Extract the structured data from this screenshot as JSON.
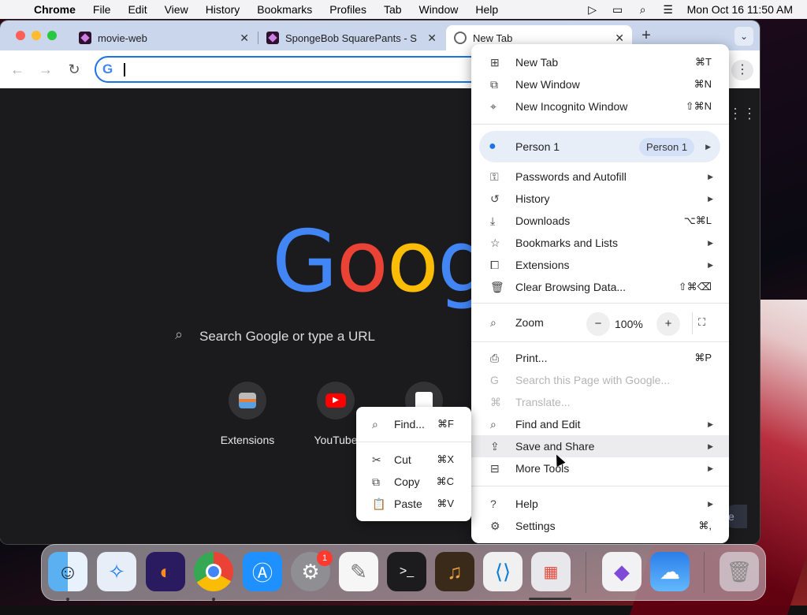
{
  "menubar": {
    "app_name": "Chrome",
    "items": [
      "File",
      "Edit",
      "View",
      "History",
      "Bookmarks",
      "Profiles",
      "Tab",
      "Window",
      "Help"
    ],
    "clock": "Mon Oct 16  11:50 AM"
  },
  "tabs": [
    {
      "title": "movie-web"
    },
    {
      "title": "SpongeBob SquarePants - S"
    },
    {
      "title": "New Tab"
    }
  ],
  "newtab_page": {
    "logo": "Google",
    "search_placeholder": "Search Google or type a URL",
    "shortcuts": [
      {
        "label": "Extensions"
      },
      {
        "label": "YouTube"
      }
    ]
  },
  "chrome_menu": {
    "new_tab": {
      "label": "New Tab",
      "shortcut": "⌘T"
    },
    "new_window": {
      "label": "New Window",
      "shortcut": "⌘N"
    },
    "new_incognito": {
      "label": "New Incognito Window",
      "shortcut": "⇧⌘N"
    },
    "person": {
      "label": "Person 1",
      "pill": "Person 1"
    },
    "passwords": {
      "label": "Passwords and Autofill"
    },
    "history": {
      "label": "History"
    },
    "downloads": {
      "label": "Downloads",
      "shortcut": "⌥⌘L"
    },
    "bookmarks": {
      "label": "Bookmarks and Lists"
    },
    "extensions": {
      "label": "Extensions"
    },
    "clear_data": {
      "label": "Clear Browsing Data...",
      "shortcut": "⇧⌘⌫"
    },
    "zoom": {
      "label": "Zoom",
      "minus": "−",
      "value": "100%",
      "plus": "+"
    },
    "print": {
      "label": "Print...",
      "shortcut": "⌘P"
    },
    "search_page": {
      "label": "Search this Page with Google..."
    },
    "translate": {
      "label": "Translate..."
    },
    "find_edit": {
      "label": "Find and Edit"
    },
    "save_share": {
      "label": "Save and Share"
    },
    "more_tools": {
      "label": "More Tools"
    },
    "help": {
      "label": "Help"
    },
    "settings": {
      "label": "Settings",
      "shortcut": "⌘,"
    }
  },
  "find_edit_submenu": {
    "find": {
      "label": "Find...",
      "shortcut": "⌘F"
    },
    "cut": {
      "label": "Cut",
      "shortcut": "⌘X"
    },
    "copy": {
      "label": "Copy",
      "shortcut": "⌘C"
    },
    "paste": {
      "label": "Paste",
      "shortcut": "⌘V"
    }
  },
  "dock": {
    "apps": [
      "finder-icon",
      "safari-icon",
      "firefox-icon",
      "chrome-icon",
      "app-store-icon",
      "system-settings-icon",
      "textedit-icon",
      "terminal-icon",
      "garageband-icon",
      "vscode-icon",
      "launchpad-icon",
      "visual-studio-icon",
      "weather-icon",
      "trash-icon"
    ],
    "settings_badge": "1"
  },
  "colors": {
    "accent": "#1a73e8",
    "tabstrip": "#c9d6ec",
    "page_bg": "#1b1b1d"
  }
}
